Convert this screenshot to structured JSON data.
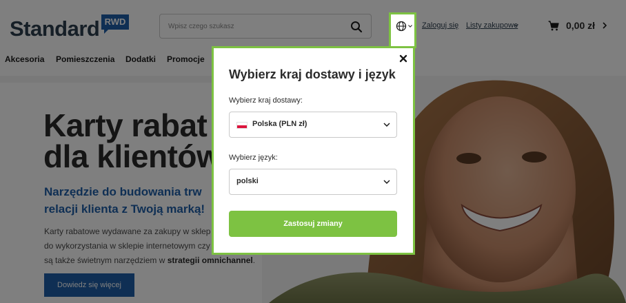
{
  "header": {
    "logo_text": "Standard",
    "logo_badge": "RWD",
    "search_placeholder": "Wpisz czego szukasz",
    "login_label": "Zaloguj się",
    "lists_label": "Listy zakupowe",
    "cart_total": "0,00 zł"
  },
  "nav": {
    "items": [
      {
        "label": "Akcesoria"
      },
      {
        "label": "Pomieszczenia"
      },
      {
        "label": "Dodatki"
      },
      {
        "label": "Promocje"
      }
    ]
  },
  "hero": {
    "title_line1": "Karty rabat",
    "title_line2": "dla klientów",
    "subtitle_line1": "Narzędzie do budowania trw",
    "subtitle_line2": "relacji klienta z Twoją marką!",
    "body_line1": "Karty rabatowe wydawane za zakupy w sklep",
    "body_line2": "do wykorzystania w sklepie internetowym czy",
    "body_line3_pre": "są także świetnym narzędziem w ",
    "body_line3_strong": "strategii omnichannel",
    "body_line3_post": ".",
    "cta_label": "Dowiedz się więcej"
  },
  "modal": {
    "title": "Wybierz kraj dostawy i język",
    "country_label": "Wybierz kraj dostawy:",
    "country_value": "Polska (PLN zł)",
    "language_label": "Wybierz język:",
    "language_value": "polski",
    "apply_label": "Zastosuj zmiany"
  },
  "colors": {
    "brand_blue": "#1f5fa8",
    "accent_green": "#7dc242",
    "logo_dark": "#2d3e4e"
  },
  "icons": {
    "search": "search-icon",
    "globe": "globe-icon",
    "cart": "cart-icon",
    "close": "close-icon",
    "chevron": "chevron-down-icon",
    "flag": "poland-flag-icon"
  }
}
